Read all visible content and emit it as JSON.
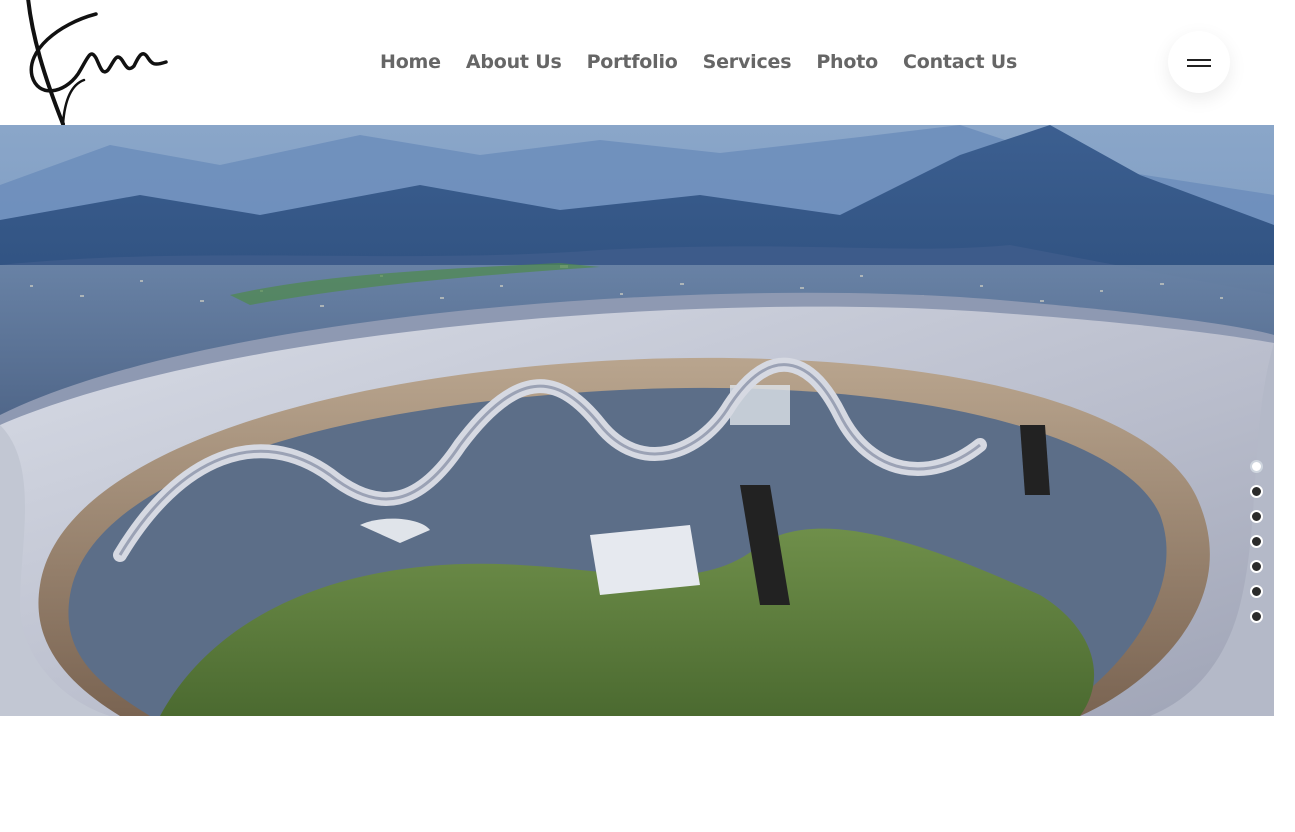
{
  "nav": {
    "items": [
      {
        "label": "Home"
      },
      {
        "label": "About Us"
      },
      {
        "label": "Portfolio"
      },
      {
        "label": "Services"
      },
      {
        "label": "Photo"
      },
      {
        "label": "Contact Us"
      }
    ]
  },
  "icons": {
    "logo": "signature-logo",
    "menu": "hamburger-menu-icon"
  },
  "hero": {
    "image": "mountain-observation-ring-photo",
    "slider": {
      "total_slides": 7,
      "active_index": 0
    }
  },
  "colors": {
    "nav_text": "#666666",
    "hero_sky": "#5d7fb0",
    "ring": "#c9cdd8"
  }
}
